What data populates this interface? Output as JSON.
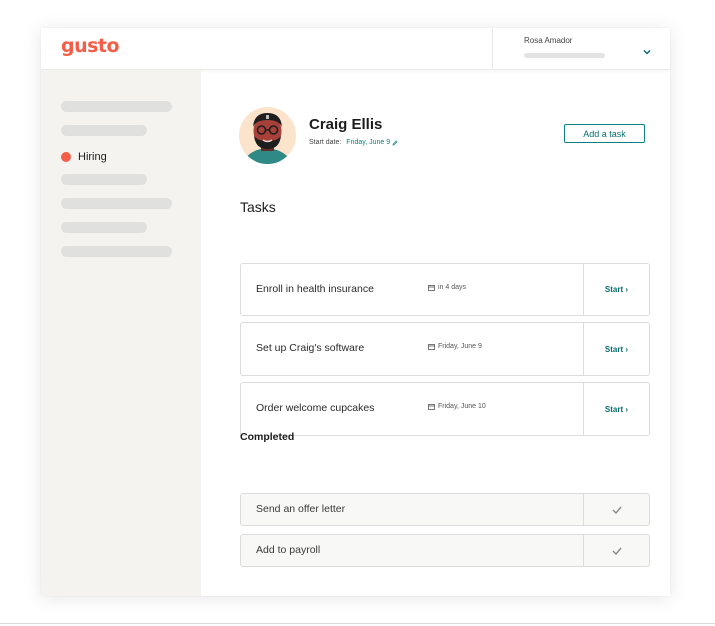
{
  "brand": {
    "logo_text": "gusto",
    "accent": "#f45d48",
    "link_color": "#0a8080"
  },
  "header": {
    "user_name": "Rosa Amador",
    "chevron_icon": "chevron-down-icon"
  },
  "sidebar": {
    "active_item": {
      "label": "Hiring",
      "dot_color": "#f45d48"
    }
  },
  "employee": {
    "name": "Craig Ellis",
    "start_label": "Start date:",
    "start_date": "Friday, June 9",
    "edit_icon": "pencil-icon"
  },
  "actions": {
    "add_task_label": "Add a task"
  },
  "tasks": {
    "title": "Tasks",
    "items": [
      {
        "name": "Enroll in health insurance",
        "due": "in 4 days",
        "action": "Start"
      },
      {
        "name": "Set up Craig's software",
        "due": "Friday, June 9",
        "action": "Start"
      },
      {
        "name": "Order welcome cupcakes",
        "due": "Friday, June 10",
        "action": "Start"
      }
    ]
  },
  "completed": {
    "title": "Completed",
    "items": [
      {
        "name": "Send an offer letter",
        "status_icon": "checkmark-icon"
      },
      {
        "name": "Add to payroll",
        "status_icon": "checkmark-icon"
      }
    ]
  }
}
